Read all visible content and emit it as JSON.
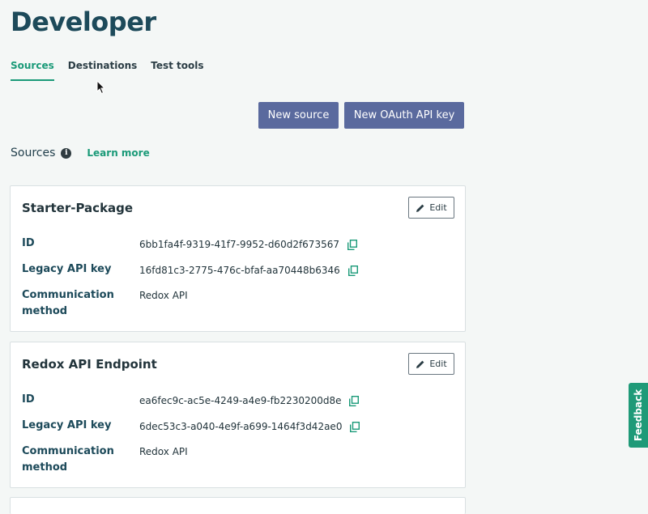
{
  "page": {
    "title": "Developer"
  },
  "tabs": [
    "Sources",
    "Destinations",
    "Test tools"
  ],
  "actions": {
    "new_source": "New source",
    "new_oauth_key": "New OAuth API key"
  },
  "section": {
    "title": "Sources",
    "info_icon": "i",
    "learn_more": "Learn more"
  },
  "cards": [
    {
      "title": "Starter-Package",
      "edit_label": "Edit",
      "id_label": "ID",
      "id_value": "6bb1fa4f-9319-41f7-9952-d60d2f673567",
      "key_label": "Legacy API key",
      "key_value": "16fd81c3-2775-476c-bfaf-aa70448b6346",
      "method_label": "Communication method",
      "method_value": "Redox API"
    },
    {
      "title": "Redox API Endpoint",
      "edit_label": "Edit",
      "id_label": "ID",
      "id_value": "ea6fec9c-ac5e-4249-a4e9-fb2230200d8e",
      "key_label": "Legacy API key",
      "key_value": "6dec53c3-a040-4e9f-a699-1464f3d42ae0",
      "method_label": "Communication method",
      "method_value": "Redox API"
    }
  ],
  "feedback": "Feedback",
  "icons": {
    "edit": "pencil-icon",
    "copy": "copy-icon",
    "info": "info-icon",
    "cursor": "mouse-cursor-icon"
  },
  "colors": {
    "accent": "#1a9a78",
    "primary_button": "#5a6a9e",
    "title": "#1d4a5a",
    "background": "#f4f7f6"
  }
}
